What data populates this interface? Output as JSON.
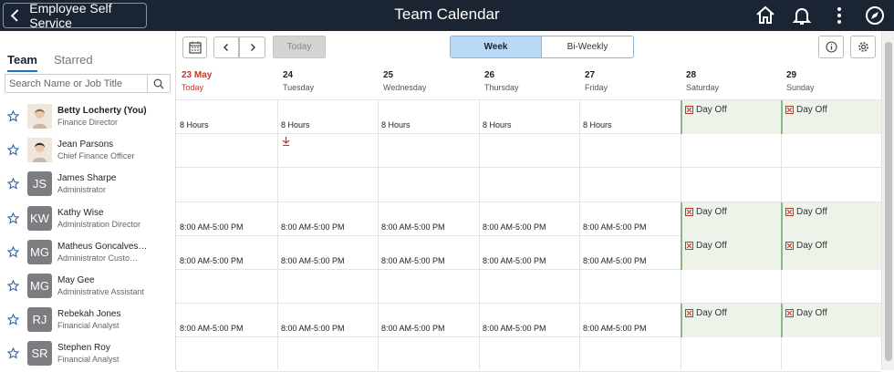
{
  "header": {
    "back_label": "Employee Self Service",
    "title": "Team Calendar",
    "icons": [
      "home-icon",
      "bell-icon",
      "more-vert-icon",
      "compass-icon"
    ]
  },
  "left": {
    "tabs": [
      {
        "label": "Team",
        "active": true
      },
      {
        "label": "Starred",
        "active": false
      }
    ],
    "search_placeholder": "Search Name or Job Title"
  },
  "people": [
    {
      "initials": "",
      "name": "Betty Locherty (You)",
      "role": "Finance Director",
      "photo": true,
      "me": true
    },
    {
      "initials": "",
      "name": "Jean Parsons",
      "role": "Chief Finance Officer",
      "photo": true,
      "me": false
    },
    {
      "initials": "JS",
      "name": "James Sharpe",
      "role": "Administrator",
      "photo": false,
      "me": false
    },
    {
      "initials": "KW",
      "name": "Kathy Wise",
      "role": "Administration Director",
      "photo": false,
      "me": false
    },
    {
      "initials": "MG",
      "name": "Matheus Goncalves…",
      "role": "Administrator Custo…",
      "photo": false,
      "me": false
    },
    {
      "initials": "MG",
      "name": "May Gee",
      "role": "Administrative Assistant",
      "photo": false,
      "me": false
    },
    {
      "initials": "RJ",
      "name": "Rebekah Jones",
      "role": "Financial Analyst",
      "photo": false,
      "me": false
    },
    {
      "initials": "SR",
      "name": "Stephen Roy",
      "role": "Financial Analyst",
      "photo": false,
      "me": false
    }
  ],
  "toolbar": {
    "today_label": "Today",
    "view_options": [
      "Week",
      "Bi-Weekly"
    ],
    "active_view": "Week"
  },
  "days": [
    {
      "date": "23 May",
      "weekday": "Today",
      "today": true
    },
    {
      "date": "24",
      "weekday": "Tuesday",
      "today": false
    },
    {
      "date": "25",
      "weekday": "Wednesday",
      "today": false
    },
    {
      "date": "26",
      "weekday": "Thursday",
      "today": false
    },
    {
      "date": "27",
      "weekday": "Friday",
      "today": false
    },
    {
      "date": "28",
      "weekday": "Saturday",
      "today": false
    },
    {
      "date": "29",
      "weekday": "Sunday",
      "today": false
    }
  ],
  "schedule": [
    [
      "8 Hours",
      "8 Hours",
      "8 Hours",
      "8 Hours",
      "8 Hours",
      "Day Off",
      "Day Off"
    ],
    [
      "",
      "icon:travel",
      "",
      "",
      "",
      "",
      ""
    ],
    [
      "",
      "",
      "",
      "",
      "",
      "",
      ""
    ],
    [
      "8:00 AM-5:00 PM",
      "8:00 AM-5:00 PM",
      "8:00 AM-5:00 PM",
      "8:00 AM-5:00 PM",
      "8:00 AM-5:00 PM",
      "Day Off",
      "Day Off"
    ],
    [
      "8:00 AM-5:00 PM",
      "8:00 AM-5:00 PM",
      "8:00 AM-5:00 PM",
      "8:00 AM-5:00 PM",
      "8:00 AM-5:00 PM",
      "Day Off",
      "Day Off"
    ],
    [
      "",
      "",
      "",
      "",
      "",
      "",
      ""
    ],
    [
      "8:00 AM-5:00 PM",
      "8:00 AM-5:00 PM",
      "8:00 AM-5:00 PM",
      "8:00 AM-5:00 PM",
      "8:00 AM-5:00 PM",
      "Day Off",
      "Day Off"
    ],
    [
      "",
      "",
      "",
      "",
      "",
      "",
      ""
    ]
  ],
  "colors": {
    "header_bg": "#1b2433",
    "today": "#c0392b",
    "accent": "#1a73c8",
    "day_off_bg": "#eef3ea"
  }
}
